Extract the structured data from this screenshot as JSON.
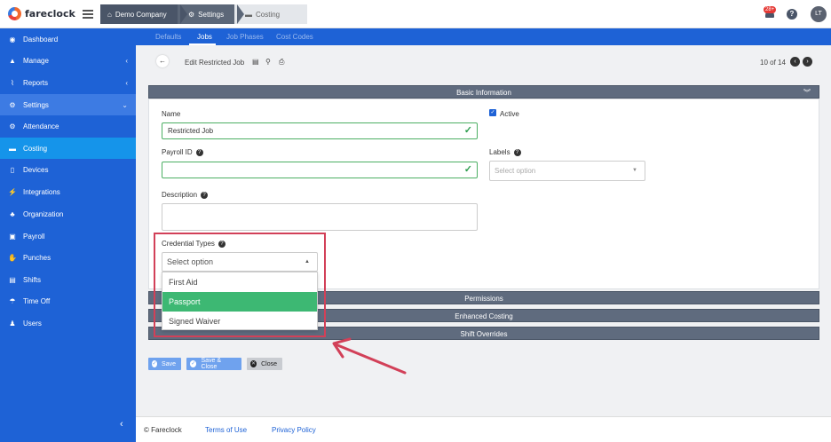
{
  "app": {
    "logo_text": "fareclock"
  },
  "breadcrumb": {
    "items": [
      "Demo Company",
      "Settings",
      "Costing"
    ]
  },
  "header_right": {
    "notification_count": "28+",
    "help": "?",
    "user_initials": "LT"
  },
  "sidebar": {
    "items": [
      {
        "label": "Dashboard",
        "icon": "dashboard-icon",
        "glyph": "◉"
      },
      {
        "label": "Manage",
        "icon": "person-icon",
        "glyph": "👤"
      },
      {
        "label": "Reports",
        "icon": "chart-icon",
        "glyph": "📈"
      },
      {
        "label": "Settings",
        "icon": "gear-icon",
        "glyph": "⚙"
      },
      {
        "label": "Attendance",
        "icon": "attendance-icon",
        "glyph": "⚙"
      },
      {
        "label": "Costing",
        "icon": "costing-icon",
        "glyph": "▬"
      },
      {
        "label": "Devices",
        "icon": "device-icon",
        "glyph": "▯"
      },
      {
        "label": "Integrations",
        "icon": "plug-icon",
        "glyph": "⚡"
      },
      {
        "label": "Organization",
        "icon": "org-icon",
        "glyph": "♣"
      },
      {
        "label": "Payroll",
        "icon": "payroll-icon",
        "glyph": "▣"
      },
      {
        "label": "Punches",
        "icon": "punch-icon",
        "glyph": "✊"
      },
      {
        "label": "Shifts",
        "icon": "shifts-icon",
        "glyph": "▤"
      },
      {
        "label": "Time Off",
        "icon": "umbrella-icon",
        "glyph": "☂"
      },
      {
        "label": "Users",
        "icon": "users-icon",
        "glyph": "👥"
      }
    ]
  },
  "subnav": {
    "tabs": [
      "Defaults",
      "Jobs",
      "Job Phases",
      "Cost Codes"
    ],
    "active": "Jobs"
  },
  "page": {
    "title": "Edit Restricted Job",
    "pager": "10 of 14"
  },
  "sections": {
    "basic": "Basic Information",
    "permissions": "Permissions",
    "enhanced": "Enhanced Costing",
    "shift": "Shift Overrides"
  },
  "form": {
    "name_label": "Name",
    "name_value": "Restricted Job",
    "active_label": "Active",
    "payroll_label": "Payroll ID",
    "payroll_value": "",
    "labels_label": "Labels",
    "labels_placeholder": "Select option",
    "description_label": "Description",
    "credential_label": "Credential Types",
    "credential_placeholder": "Select option",
    "credential_options": [
      "First Aid",
      "Passport",
      "Signed Waiver"
    ],
    "credential_highlighted": "Passport"
  },
  "buttons": {
    "save": "Save",
    "save_close": "Save & Close",
    "close": "Close"
  },
  "footer": {
    "copyright": "© Fareclock",
    "terms": "Terms of Use",
    "privacy": "Privacy Policy"
  },
  "colors": {
    "primary": "#1e62d6",
    "success": "#3db873",
    "annotation": "#d24058"
  }
}
